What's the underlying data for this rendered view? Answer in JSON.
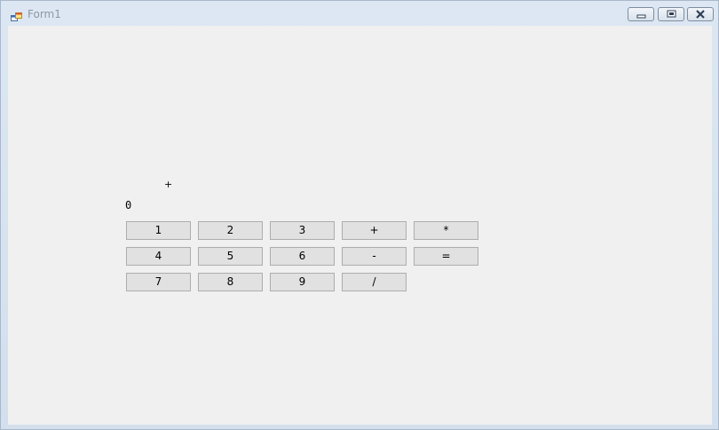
{
  "window": {
    "title": "Form1"
  },
  "calculator": {
    "operator_display": "+",
    "value_display": "0",
    "buttons": {
      "b1": "1",
      "b2": "2",
      "b3": "3",
      "plus": "+",
      "multiply": "*",
      "b4": "4",
      "b5": "5",
      "b6": "6",
      "minus": "-",
      "equals": "=",
      "b7": "7",
      "b8": "8",
      "b9": "9",
      "divide": "/"
    }
  }
}
